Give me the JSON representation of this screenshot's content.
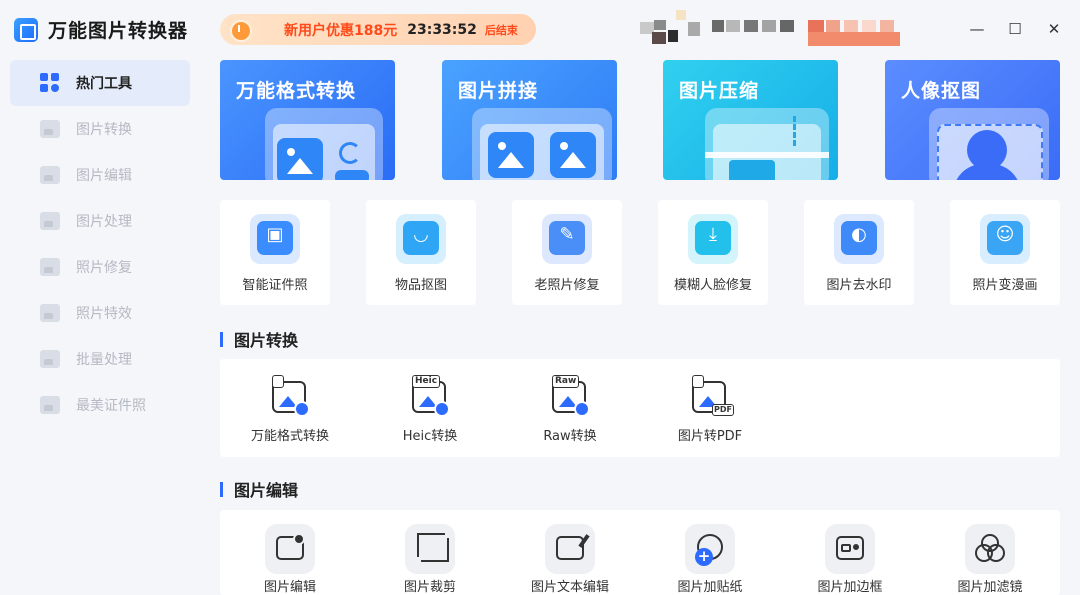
{
  "app": {
    "title": "万能图片转换器"
  },
  "sidebar": {
    "items": [
      {
        "label": "热门工具",
        "icon": "grid-icon",
        "active": true
      },
      {
        "label": "图片转换",
        "icon": "image-convert-icon"
      },
      {
        "label": "图片编辑",
        "icon": "image-edit-icon"
      },
      {
        "label": "图片处理",
        "icon": "image-process-icon"
      },
      {
        "label": "照片修复",
        "icon": "photo-repair-icon"
      },
      {
        "label": "照片特效",
        "icon": "photo-effect-icon"
      },
      {
        "label": "批量处理",
        "icon": "batch-icon"
      },
      {
        "label": "最美证件照",
        "icon": "id-photo-icon"
      }
    ]
  },
  "promo": {
    "text": "新用户优惠188元",
    "countdown": "23:33:52",
    "suffix": "后结束"
  },
  "window_controls": {
    "minimize": "—",
    "maximize": "☐",
    "close": "✕"
  },
  "banners": [
    {
      "label": "万能格式转换",
      "color_from": "#4a95ff",
      "color_to": "#2a6cf5"
    },
    {
      "label": "图片拼接",
      "color_from": "#4aa2ff",
      "color_to": "#2f7cf6"
    },
    {
      "label": "图片压缩",
      "color_from": "#31d0ef",
      "color_to": "#16aee8"
    },
    {
      "label": "人像抠图",
      "color_from": "#5b8dff",
      "color_to": "#3a6cf7"
    }
  ],
  "tools": [
    {
      "label": "智能证件照",
      "icon": "id-card-icon",
      "color": "#3a8cff"
    },
    {
      "label": "物品抠图",
      "icon": "bag-icon",
      "color": "#2fa6f5"
    },
    {
      "label": "老照片修复",
      "icon": "wrench-icon",
      "color": "#4a8ff7"
    },
    {
      "label": "模糊人脸修复",
      "icon": "download-face-icon",
      "color": "#22c0ea"
    },
    {
      "label": "图片去水印",
      "icon": "watermark-remove-icon",
      "color": "#3d8af8"
    },
    {
      "label": "照片变漫画",
      "icon": "bear-icon",
      "color": "#3aa4f5"
    }
  ],
  "sections": {
    "convert": {
      "title": "图片转换",
      "items": [
        {
          "label": "万能格式转换",
          "tag": "",
          "icon": "format-convert-icon"
        },
        {
          "label": "Heic转换",
          "tag": "Heic",
          "icon": "heic-icon"
        },
        {
          "label": "Raw转换",
          "tag": "Raw",
          "icon": "raw-icon"
        },
        {
          "label": "图片转PDF",
          "tag": "PDF",
          "icon": "pdf-icon"
        }
      ]
    },
    "edit": {
      "title": "图片编辑",
      "items": [
        {
          "label": "图片编辑",
          "icon": "image-settings-icon"
        },
        {
          "label": "图片裁剪",
          "icon": "crop-icon"
        },
        {
          "label": "图片文本编辑",
          "icon": "text-edit-icon"
        },
        {
          "label": "图片加贴纸",
          "icon": "sticker-icon"
        },
        {
          "label": "图片加边框",
          "icon": "border-icon"
        },
        {
          "label": "图片加滤镜",
          "icon": "filter-icon"
        }
      ]
    }
  }
}
